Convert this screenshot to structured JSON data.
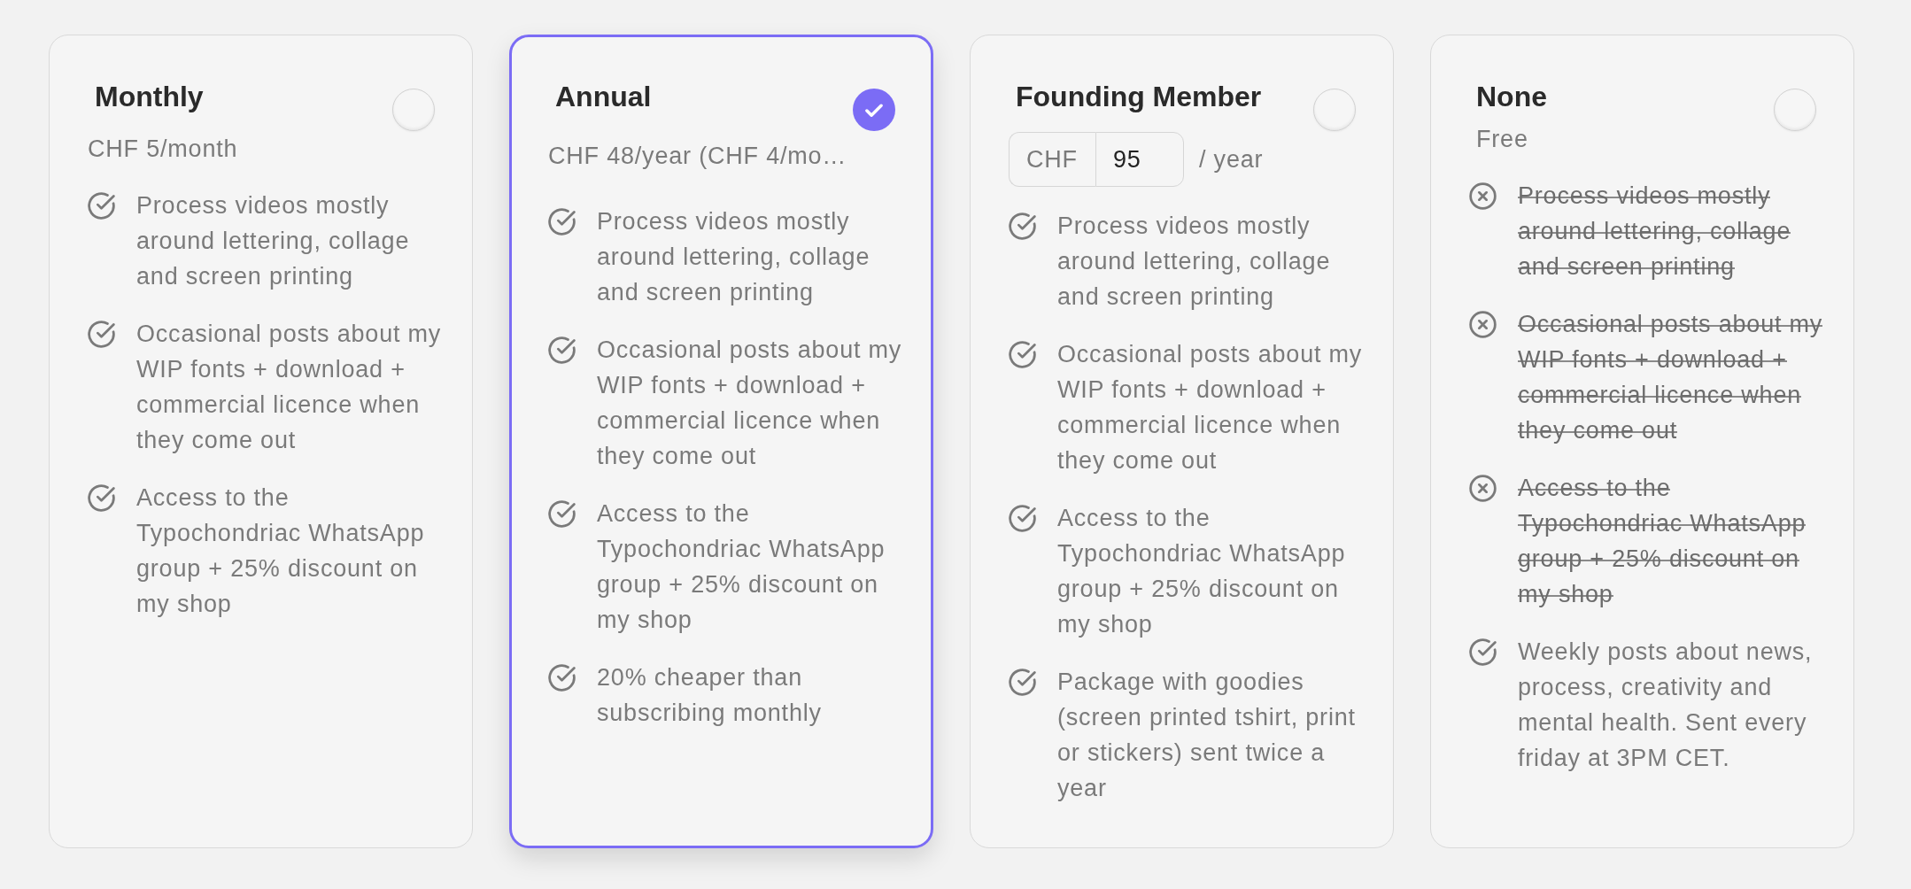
{
  "plans": [
    {
      "name": "Monthly",
      "selected": false,
      "price": {
        "kind": "text",
        "text": "CHF 5/month"
      },
      "features": [
        {
          "included": true,
          "text": "Process videos mostly around lettering, collage and screen printing"
        },
        {
          "included": true,
          "text": "Occasional posts about my WIP fonts + download + commercial licence when they come out"
        },
        {
          "included": true,
          "text": "Access to the Typochondriac WhatsApp group + 25% discount on my shop"
        }
      ]
    },
    {
      "name": "Annual",
      "selected": true,
      "price": {
        "kind": "clipped",
        "text": "CHF 48/year (CHF 4/mo…"
      },
      "features": [
        {
          "included": true,
          "text": "Process videos mostly around lettering, collage and screen printing"
        },
        {
          "included": true,
          "text": "Occasional posts about my WIP fonts + download + commercial licence when they come out"
        },
        {
          "included": true,
          "text": "Access to the Typochondriac WhatsApp group + 25% discount on my shop"
        },
        {
          "included": true,
          "text": "20% cheaper than subscribing monthly"
        }
      ]
    },
    {
      "name": "Founding Member",
      "selected": false,
      "price": {
        "kind": "custom",
        "currency": "CHF",
        "value": "95",
        "period": "/ year"
      },
      "features": [
        {
          "included": true,
          "text": "Process videos mostly around lettering, collage and screen printing"
        },
        {
          "included": true,
          "text": "Occasional posts about my WIP fonts + download + commercial licence when they come out"
        },
        {
          "included": true,
          "text": "Access to the Typochondriac WhatsApp group + 25% discount on my shop"
        },
        {
          "included": true,
          "text": "Package with goodies (screen printed tshirt, print or stickers) sent twice a year"
        }
      ]
    },
    {
      "name": "None",
      "selected": false,
      "price": {
        "kind": "free",
        "text": "Free"
      },
      "features": [
        {
          "included": false,
          "text": "Process videos mostly around lettering, collage and screen printing"
        },
        {
          "included": false,
          "text": "Occasional posts about my WIP fonts + download + commercial licence when they come out"
        },
        {
          "included": false,
          "text": "Access to the Typochondriac WhatsApp group + 25% discount on my shop"
        },
        {
          "included": true,
          "text": "Weekly posts about news, process, creativity and mental health. Sent every friday at 3PM CET."
        }
      ]
    }
  ]
}
